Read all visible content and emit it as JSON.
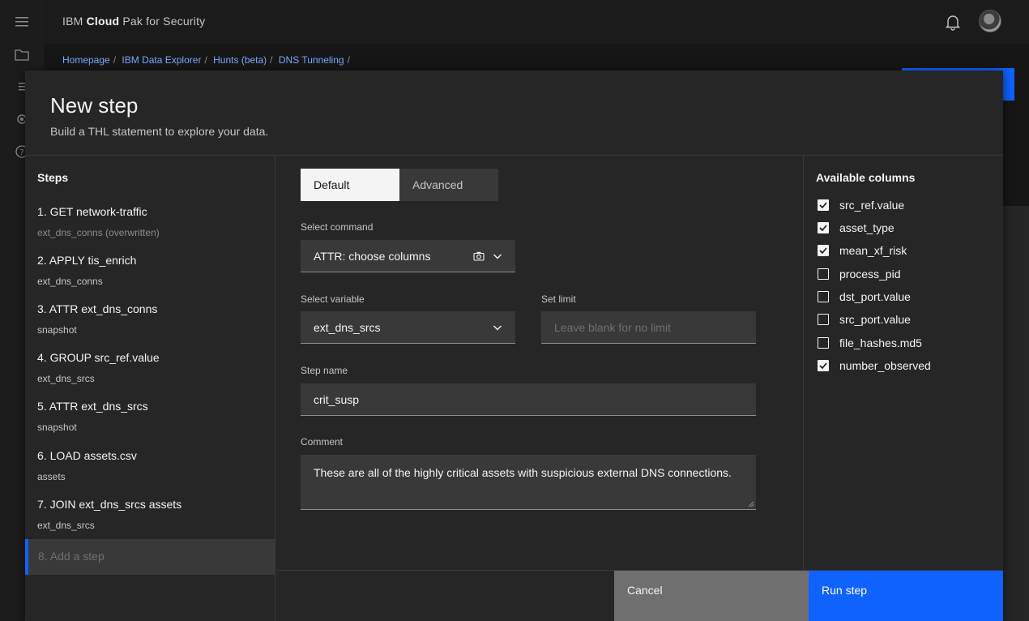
{
  "app": {
    "brand_prefix": "IBM",
    "brand_bold": "Cloud",
    "brand_suffix": "Pak for Security"
  },
  "breadcrumb": [
    "Homepage",
    "IBM Data Explorer",
    "Hunts (beta)",
    "DNS Tunneling"
  ],
  "breadcrumb_sep": "/",
  "modal": {
    "title": "New step",
    "subtitle": "Build a THL statement to explore your data."
  },
  "steps": {
    "title": "Steps",
    "items": [
      {
        "name": "1. GET network-traffic",
        "sub": "ext_dns_conns (overwritten)"
      },
      {
        "name": "2. APPLY tis_enrich",
        "sub": "ext_dns_conns"
      },
      {
        "name": "3. ATTR ext_dns_conns",
        "sub": "snapshot"
      },
      {
        "name": "4. GROUP src_ref.value",
        "sub": "ext_dns_srcs"
      },
      {
        "name": "5. ATTR ext_dns_srcs",
        "sub": "snapshot"
      },
      {
        "name": "6. LOAD assets.csv",
        "sub": "assets"
      },
      {
        "name": "7. JOIN ext_dns_srcs assets",
        "sub": "ext_dns_srcs"
      }
    ],
    "add_step": "8. Add a step"
  },
  "form": {
    "mode_default": "Default",
    "mode_advanced": "Advanced",
    "command_label": "Select command",
    "command_value": "ATTR: choose columns",
    "variable_label": "Select variable",
    "variable_value": "ext_dns_srcs",
    "limit_label": "Set limit",
    "limit_placeholder": "Leave blank for no limit",
    "step_name_label": "Step name",
    "step_name_value": "crit_susp",
    "comment_label": "Comment",
    "comment_value": "These are all of the highly critical assets with suspicious external DNS connections."
  },
  "columns": {
    "title": "Available columns",
    "items": [
      {
        "label": "src_ref.value",
        "checked": true
      },
      {
        "label": "asset_type",
        "checked": true
      },
      {
        "label": "mean_xf_risk",
        "checked": true
      },
      {
        "label": "process_pid",
        "checked": false
      },
      {
        "label": "dst_port.value",
        "checked": false
      },
      {
        "label": "src_port.value",
        "checked": false
      },
      {
        "label": "file_hashes.md5",
        "checked": false
      },
      {
        "label": "number_observed",
        "checked": true
      }
    ]
  },
  "footer": {
    "cancel": "Cancel",
    "run": "Run step"
  },
  "colors": {
    "accent": "#0f62fe",
    "background": "#161616",
    "modal": "#262626",
    "field": "#393939"
  }
}
